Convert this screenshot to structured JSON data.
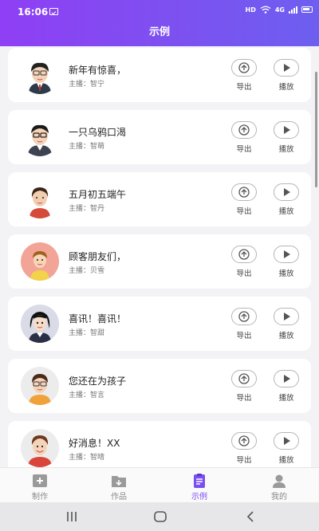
{
  "status_bar": {
    "time": "16:06",
    "network": "HD",
    "network_type": "4G"
  },
  "header": {
    "title": "示例"
  },
  "actions": {
    "export_label": "导出",
    "play_label": "播放"
  },
  "items": [
    {
      "title": "新年有惊喜，",
      "anchor": "主播：智宁"
    },
    {
      "title": "一只乌鸦口渴",
      "anchor": "主播：智萌"
    },
    {
      "title": "五月初五端午",
      "anchor": "主播：智丹"
    },
    {
      "title": "顾客朋友们，",
      "anchor": "主播：贝雪"
    },
    {
      "title": "喜讯！喜讯！",
      "anchor": "主播：智甜"
    },
    {
      "title": "您还在为孩子",
      "anchor": "主播：智言"
    },
    {
      "title": "好消息！XX",
      "anchor": "主播：智晴"
    }
  ],
  "tabs": [
    {
      "label": "制作",
      "icon": "add-box-icon"
    },
    {
      "label": "作品",
      "icon": "folder-icon"
    },
    {
      "label": "示例",
      "icon": "clipboard-icon",
      "active": true
    },
    {
      "label": "我的",
      "icon": "person-icon"
    }
  ],
  "colors": {
    "accent": "#7a4ef0",
    "header_start": "#8f3ff5",
    "header_end": "#6d5ff0",
    "background": "#f3f3f6"
  }
}
